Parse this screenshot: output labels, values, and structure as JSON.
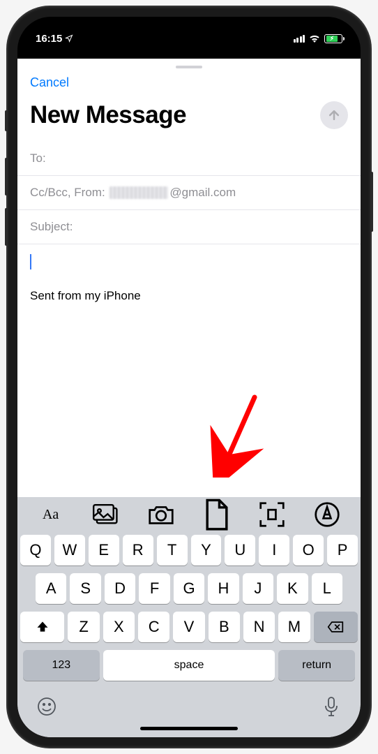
{
  "status_bar": {
    "time": "16:15"
  },
  "header": {
    "cancel_label": "Cancel",
    "title": "New Message"
  },
  "fields": {
    "to_label": "To:",
    "ccbcc_from_label": "Cc/Bcc, From:",
    "email_domain": "@gmail.com",
    "subject_label": "Subject:"
  },
  "compose": {
    "signature": "Sent from my iPhone"
  },
  "toolbar": {
    "items": [
      "text-format",
      "photo-library",
      "camera",
      "attach-document",
      "scan-document",
      "markup"
    ]
  },
  "keyboard": {
    "row1": [
      "Q",
      "W",
      "E",
      "R",
      "T",
      "Y",
      "U",
      "I",
      "O",
      "P"
    ],
    "row2": [
      "A",
      "S",
      "D",
      "F",
      "G",
      "H",
      "J",
      "K",
      "L"
    ],
    "row3": [
      "Z",
      "X",
      "C",
      "V",
      "B",
      "N",
      "M"
    ],
    "numbers_label": "123",
    "space_label": "space",
    "return_label": "return"
  }
}
